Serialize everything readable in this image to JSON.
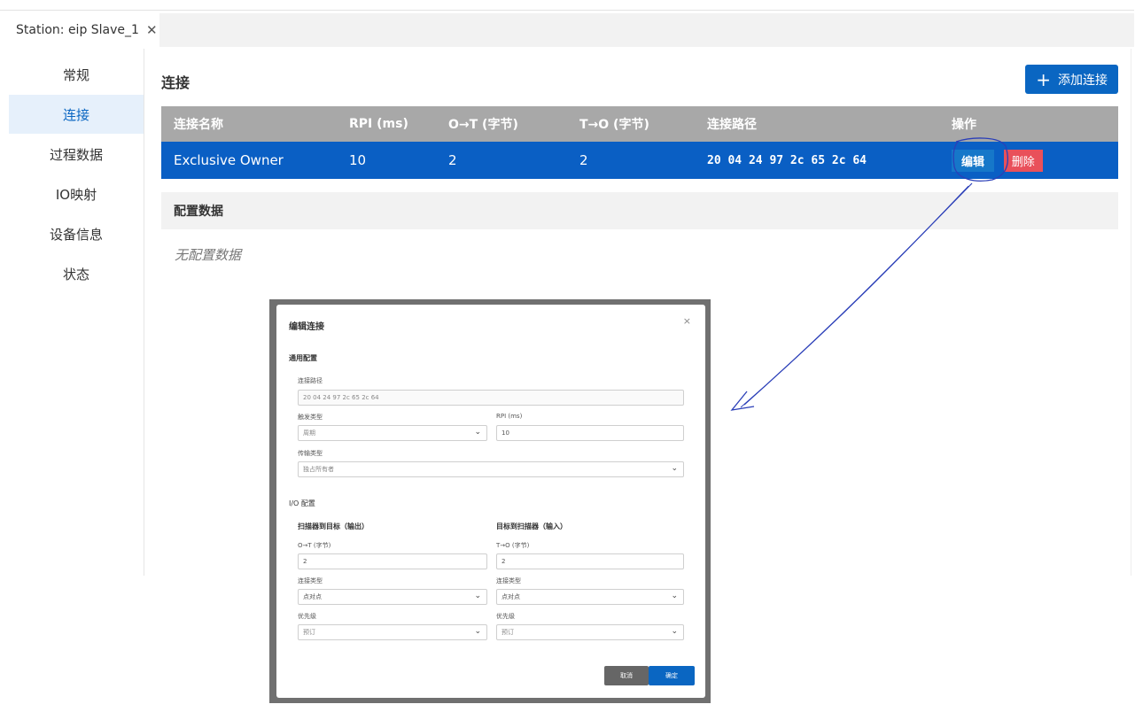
{
  "tab": {
    "title": "Station: eip Slave_1",
    "close_glyph": "✕"
  },
  "sidebar": {
    "items": [
      {
        "label": "常规"
      },
      {
        "label": "连接"
      },
      {
        "label": "过程数据"
      },
      {
        "label": "IO映射"
      },
      {
        "label": "设备信息"
      },
      {
        "label": "状态"
      }
    ]
  },
  "main": {
    "title": "连接",
    "add_button": {
      "icon": "plus-icon",
      "plus_glyph": "+",
      "label": "添加连接"
    },
    "table": {
      "headers": [
        "连接名称",
        "RPI (ms)",
        "O→T (字节)",
        "T→O (字节)",
        "连接路径",
        "操作"
      ],
      "rows": [
        {
          "name": "Exclusive Owner",
          "rpi": "10",
          "ot": "2",
          "to": "2",
          "path": "20 04 24 97 2c 65 2c 64",
          "edit_label": "编辑",
          "delete_label": "删除"
        }
      ]
    },
    "config_title": "配置数据",
    "no_config": "无配置数据"
  },
  "modal": {
    "title": "编辑连接",
    "close_glyph": "×",
    "general_title": "通用配置",
    "path_label": "连接路径",
    "path_value": "20 04 24 97 2c 65 2c 64",
    "trigger_label": "触发类型",
    "trigger_value": "周期",
    "rpi_label": "RPI (ms)",
    "rpi_value": "10",
    "transport_label": "传输类型",
    "transport_value": "独占所有者",
    "io_title": "I/O 配置",
    "out_title": "扫描器到目标（输出）",
    "in_title": "目标到扫描器（输入）",
    "ot_label": "O→T (字节)",
    "ot_value": "2",
    "to_label": "T→O (字节)",
    "to_value": "2",
    "out_conn_type_label": "连接类型",
    "out_conn_type_value": "点对点",
    "in_conn_type_label": "连接类型",
    "in_conn_type_value": "点对点",
    "out_priority_label": "优先级",
    "out_priority_value": "预订",
    "in_priority_label": "优先级",
    "in_priority_value": "预订",
    "cancel_label": "取消",
    "ok_label": "确定",
    "chevron_glyph": "⌄"
  },
  "colors": {
    "accent": "#0a66c2",
    "row_selected": "#0a5fc4",
    "header_gray": "#a8a8a8",
    "danger": "#e9505a",
    "annotation": "#2b3fb8"
  }
}
